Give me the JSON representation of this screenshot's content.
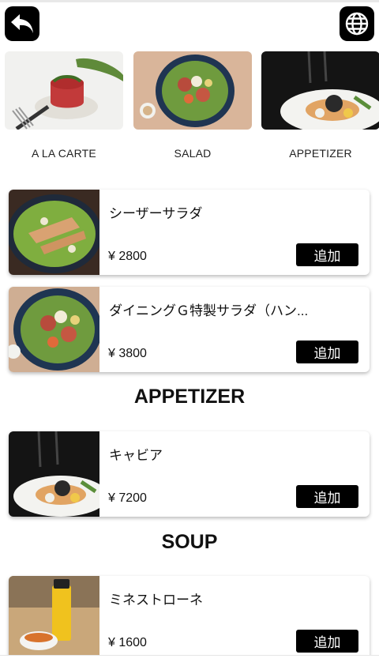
{
  "nav": {
    "back_icon": "back-arrow-icon",
    "language_icon": "globe-icon"
  },
  "categories": [
    {
      "label": "A LA CARTE"
    },
    {
      "label": "SALAD"
    },
    {
      "label": "APPETIZER"
    }
  ],
  "salad_items": [
    {
      "name": "シーザーサラダ",
      "price": "¥ 2800",
      "add_label": "追加"
    },
    {
      "name": "ダイニングＧ特製サラダ（ハン...",
      "price": "¥ 3800",
      "add_label": "追加"
    }
  ],
  "appetizer": {
    "heading": "APPETIZER",
    "items": [
      {
        "name": "キャビア",
        "price": "¥ 7200",
        "add_label": "追加"
      }
    ]
  },
  "soup": {
    "heading": "SOUP",
    "items": [
      {
        "name": "ミネストローネ",
        "price": "¥ 1600",
        "add_label": "追加"
      }
    ]
  },
  "colors": {
    "button_bg": "#000000",
    "button_text": "#ffffff",
    "background": "#ffffff"
  }
}
